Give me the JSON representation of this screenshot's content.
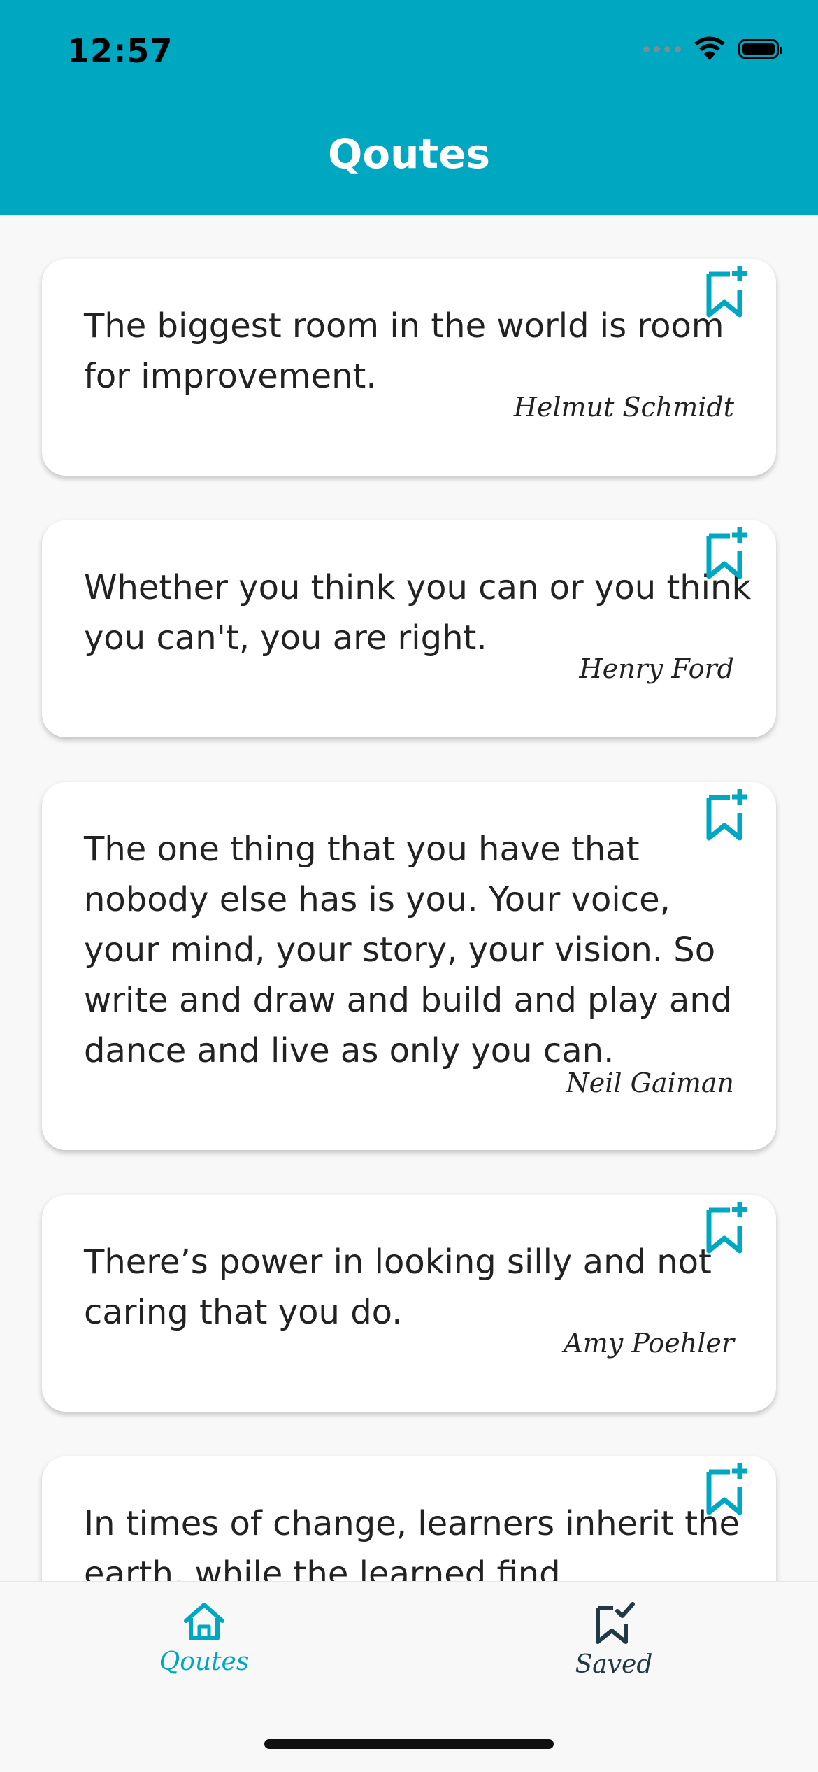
{
  "status_bar": {
    "time": "12:57"
  },
  "header": {
    "title": "Qoutes"
  },
  "quotes": [
    {
      "text": "The biggest room in the world is room for improvement.",
      "author": "Helmut Schmidt"
    },
    {
      "text": "Whether you think you can or you think you can't, you are right.",
      "author": "Henry Ford"
    },
    {
      "text": "The one thing that you have that nobody else has is you. Your voice, your mind, your story, your vision. So write and draw and build and play and dance and live as only you can.",
      "author": "Neil Gaiman"
    },
    {
      "text": "There’s power in looking silly and not caring that you do.",
      "author": "Amy Poehler"
    },
    {
      "text": "In times of change, learners inherit the earth, while the learned find",
      "author": ""
    }
  ],
  "tabs": [
    {
      "label": "Qoutes",
      "icon": "home-icon",
      "active": true
    },
    {
      "label": "Saved",
      "icon": "bookmark-check-icon",
      "active": false
    }
  ],
  "colors": {
    "accent": "#00a7c1",
    "tab_inactive": "#1f3a44",
    "text": "#222222"
  }
}
